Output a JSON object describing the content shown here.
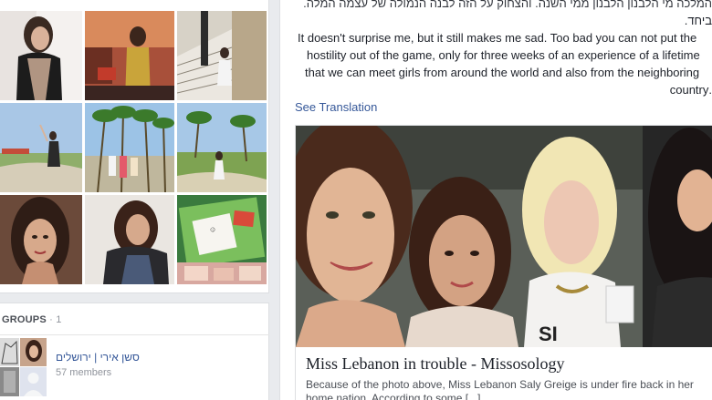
{
  "groups": {
    "header_label": "GROUPS",
    "header_separator": " · ",
    "count": "1",
    "items": [
      {
        "name": "סשן אירי | ירושלים",
        "members": "57 members"
      }
    ]
  },
  "post": {
    "text_lines": [
      "המלכה מי הלבנון הלבנון ממי השנה. והצחוק על הזה לבנה הנמולה של עצמה המלה.",
      "ביחד.",
      "It doesn't surprise me, but it still makes me sad. Too bad you can not put the",
      "hostility out of the game, only for three weeks of an experience of a lifetime",
      "that we can meet girls from around the world and also from the neighboring",
      ".country"
    ],
    "see_translation": "See Translation",
    "link": {
      "title": "Miss Lebanon in trouble - Missosology",
      "description": "Because of the photo above, Miss Lebanon Saly Greige is under fire back in her home nation. According to some [...]",
      "image_label": "SI"
    }
  },
  "colors": {
    "link_blue": "#365899",
    "background": "#e9ebee",
    "card": "#ffffff"
  }
}
